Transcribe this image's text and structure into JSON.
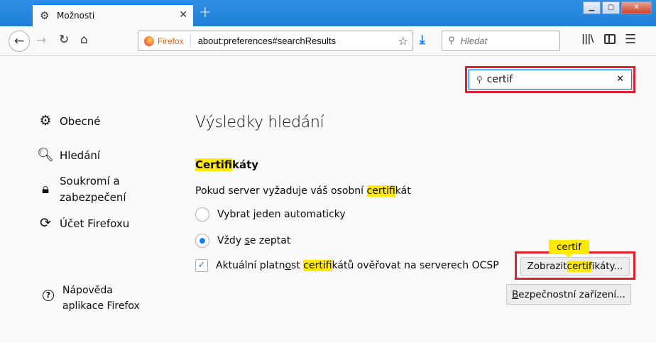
{
  "tab": {
    "title": "Možnosti",
    "close": "✕",
    "icon": "gear-icon"
  },
  "window_controls": {
    "minimize": "▁",
    "maximize": "▢",
    "close": "✕"
  },
  "nav": {
    "identity_label": "Firefox",
    "url": "about:preferences#searchResults",
    "search_placeholder": "Hledat"
  },
  "prefs_search": {
    "value": "certif"
  },
  "sidebar": {
    "items": [
      {
        "label": "Obecné",
        "icon": "gear-icon"
      },
      {
        "label": "Hledání",
        "icon": "search-icon"
      },
      {
        "label_line1": "Soukromí a",
        "label_line2": "zabezpečení",
        "icon": "lock-icon"
      },
      {
        "label": "Účet Firefoxu",
        "icon": "sync-icon"
      }
    ],
    "help_line1": "Nápověda",
    "help_line2": "aplikace Firefox"
  },
  "main": {
    "title": "Výsledky hledání",
    "section": {
      "hl": "Certif",
      "rest": "ikáty"
    },
    "description": {
      "pre": "Pokud server vyžaduje váš osobní ",
      "hl": "certif",
      "post": "ikát"
    },
    "radio_auto": "Vybrat jeden automaticky",
    "radio_ask": {
      "pre": "Vždy ",
      "underlined": "s",
      "post": "e zeptat"
    },
    "ocsp": {
      "pre": "Aktuální platn",
      "underlined": "o",
      "mid": "st ",
      "hl": "certif",
      "post": "ikátů ověřovat na serverech OCSP",
      "checked": true
    },
    "tooltip": "certif",
    "view_button": {
      "pre": "Zobrazit ",
      "hl": "certif",
      "post": "ikáty..."
    },
    "devices_button": {
      "underlined": "B",
      "rest": "ezpečnostní zařízení..."
    }
  },
  "colors": {
    "accent": "#0a84ff",
    "highlight": "#ffe900",
    "annotation": "#e0202f"
  }
}
